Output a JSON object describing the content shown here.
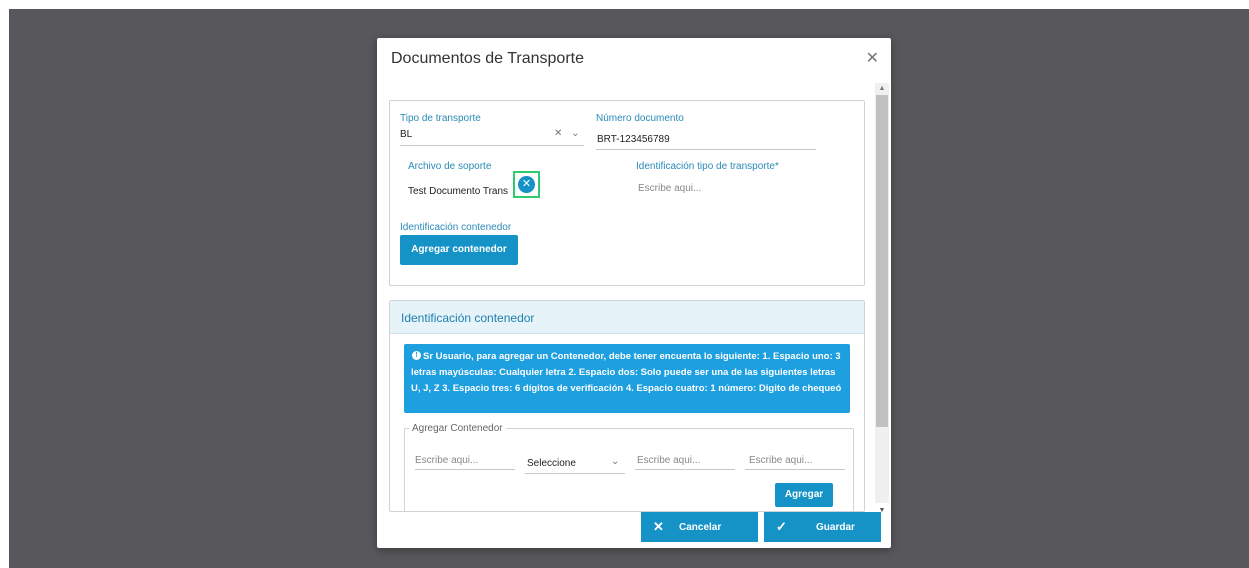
{
  "modal": {
    "title": "Documentos de Transporte"
  },
  "form": {
    "tipo_transporte": {
      "label": "Tipo de transporte",
      "value": "BL"
    },
    "numero_documento": {
      "label": "Número documento",
      "value": "BRT-123456789"
    },
    "archivo_soporte": {
      "label": "Archivo de soporte",
      "file_name": "Test Documento Trans"
    },
    "identificacion_tipo": {
      "label": "Identificación tipo de transporte*",
      "placeholder": "Escribe aqui..."
    },
    "identificacion_contenedor": {
      "label": "Identificación contenedor",
      "button": "Agregar contenedor"
    }
  },
  "contenedor_panel": {
    "title": "Identificación contenedor",
    "info": "Sr Usuario, para agregar un Contenedor, debe tener encuenta lo siguiente: 1. Espacio uno: 3 letras mayúsculas: Cualquier letra 2. Espacio dos: Solo puede ser una de las siguientes letras U, J, Z 3. Espacio tres: 6 dígitos de verificación 4. Espacio cuatro: 1 número: Digito de chequeó",
    "fieldset_legend": "Agregar Contenedor",
    "field1_placeholder": "Escribe aqui...",
    "select_value": "Seleccione",
    "field3_placeholder": "Escribe aqui...",
    "field4_placeholder": "Escribe aqui...",
    "add_button": "Agregar"
  },
  "footer": {
    "cancel": "Cancelar",
    "save": "Guardar"
  },
  "colors": {
    "accent": "#1593c7",
    "info_bg": "#1e9fe0",
    "label": "#2a8ab7",
    "overlay": "#58575b",
    "focus": "#2ecc71"
  }
}
